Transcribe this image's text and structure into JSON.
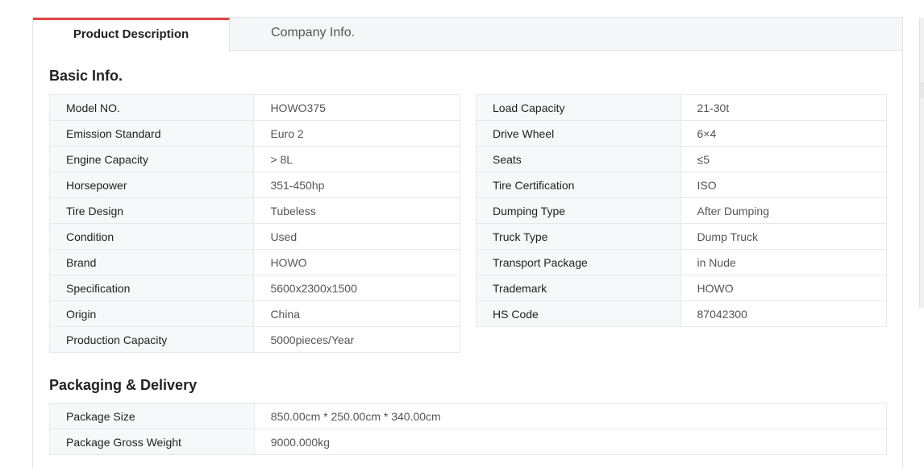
{
  "tabs": [
    {
      "label": "Product Description",
      "active": true
    },
    {
      "label": "Company Info.",
      "active": false
    }
  ],
  "basic_info": {
    "title": "Basic Info.",
    "left": [
      {
        "key": "Model NO.",
        "value": "HOWO375"
      },
      {
        "key": "Emission Standard",
        "value": "Euro 2"
      },
      {
        "key": "Engine Capacity",
        "value": " > 8L"
      },
      {
        "key": "Horsepower",
        "value": "351-450hp"
      },
      {
        "key": "Tire Design",
        "value": "Tubeless"
      },
      {
        "key": "Condition",
        "value": "Used"
      },
      {
        "key": "Brand",
        "value": "HOWO"
      },
      {
        "key": "Specification",
        "value": "5600x2300x1500"
      },
      {
        "key": "Origin",
        "value": "China"
      },
      {
        "key": "Production Capacity",
        "value": "5000pieces/Year"
      }
    ],
    "right": [
      {
        "key": "Load Capacity",
        "value": "21-30t"
      },
      {
        "key": "Drive Wheel",
        "value": "6×4"
      },
      {
        "key": "Seats",
        "value": "≤5"
      },
      {
        "key": "Tire Certification",
        "value": "ISO"
      },
      {
        "key": "Dumping Type",
        "value": "After Dumping"
      },
      {
        "key": "Truck Type",
        "value": "Dump Truck"
      },
      {
        "key": "Transport Package",
        "value": "in Nude"
      },
      {
        "key": "Trademark",
        "value": "HOWO"
      },
      {
        "key": "HS Code",
        "value": "87042300"
      }
    ]
  },
  "packaging": {
    "title": "Packaging & Delivery",
    "rows": [
      {
        "key": "Package Size",
        "value": "850.00cm * 250.00cm * 340.00cm"
      },
      {
        "key": "Package Gross Weight",
        "value": "9000.000kg"
      }
    ]
  },
  "colors": {
    "accent": "#e64545",
    "key_bg": "#f7f8fa",
    "border": "#e8e8e8"
  }
}
